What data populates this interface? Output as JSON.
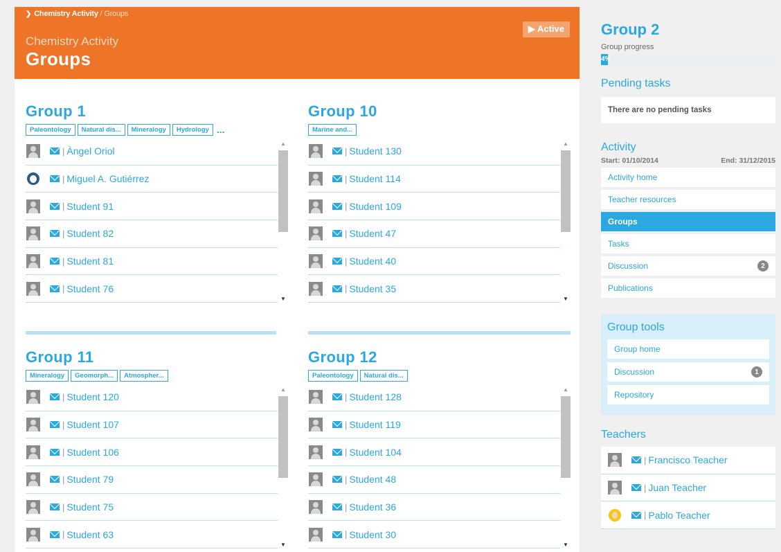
{
  "breadcrumb": {
    "parent": "Chemistry Activity",
    "separator": "/",
    "current": "Groups"
  },
  "hero": {
    "subtitle": "Chemistry Activity",
    "title": "Groups",
    "status": "Active"
  },
  "groups": [
    {
      "title": "Group 1",
      "tags": [
        "Paleontology",
        "Natural dis...",
        "Mineralogy",
        "Hydrology"
      ],
      "more": "...",
      "members": [
        {
          "name": "Àngel Oriol",
          "avatar": "default"
        },
        {
          "name": "Miguel A. Gutiérrez",
          "avatar": "penguin"
        },
        {
          "name": "Student 91",
          "avatar": "default"
        },
        {
          "name": "Student 82",
          "avatar": "default"
        },
        {
          "name": "Student 81",
          "avatar": "default"
        },
        {
          "name": "Student 76",
          "avatar": "default"
        }
      ]
    },
    {
      "title": "Group 10",
      "tags": [
        "Marine and..."
      ],
      "more": "",
      "members": [
        {
          "name": "Student 130",
          "avatar": "default"
        },
        {
          "name": "Student 114",
          "avatar": "default"
        },
        {
          "name": "Student 109",
          "avatar": "default"
        },
        {
          "name": "Student 47",
          "avatar": "default"
        },
        {
          "name": "Student 40",
          "avatar": "default"
        },
        {
          "name": "Student 35",
          "avatar": "default"
        }
      ]
    },
    {
      "title": "Group 11",
      "tags": [
        "Mineralogy",
        "Geomorph...",
        "Atmospher..."
      ],
      "more": "",
      "members": [
        {
          "name": "Student 120",
          "avatar": "default"
        },
        {
          "name": "Student 107",
          "avatar": "default"
        },
        {
          "name": "Student 106",
          "avatar": "default"
        },
        {
          "name": "Student 79",
          "avatar": "default"
        },
        {
          "name": "Student 75",
          "avatar": "default"
        },
        {
          "name": "Student 63",
          "avatar": "default"
        }
      ]
    },
    {
      "title": "Group 12",
      "tags": [
        "Paleontology",
        "Natural dis..."
      ],
      "more": "",
      "members": [
        {
          "name": "Student 128",
          "avatar": "default"
        },
        {
          "name": "Student 119",
          "avatar": "default"
        },
        {
          "name": "Student 104",
          "avatar": "default"
        },
        {
          "name": "Student 48",
          "avatar": "default"
        },
        {
          "name": "Student 36",
          "avatar": "default"
        },
        {
          "name": "Student 30",
          "avatar": "default"
        }
      ]
    }
  ],
  "sidebar": {
    "group_title": "Group 2",
    "progress_label": "Group progress",
    "progress_text": "4%",
    "progress_value": 4,
    "pending_heading": "Pending tasks",
    "pending_text": "There are no pending tasks",
    "activity_heading": "Activity",
    "start": "Start: 01/10/2014",
    "end": "End: 31/12/2015",
    "activity_menu": [
      {
        "label": "Activity home",
        "badge": "",
        "active": false
      },
      {
        "label": "Teacher resources",
        "badge": "",
        "active": false
      },
      {
        "label": "Groups",
        "badge": "",
        "active": true
      },
      {
        "label": "Tasks",
        "badge": "",
        "active": false
      },
      {
        "label": "Discussion",
        "badge": "2",
        "active": false
      },
      {
        "label": "Publications",
        "badge": "",
        "active": false
      }
    ],
    "tools_heading": "Group tools",
    "tools_menu": [
      {
        "label": "Group home",
        "badge": ""
      },
      {
        "label": "Discussion",
        "badge": "1"
      },
      {
        "label": "Repository",
        "badge": ""
      }
    ],
    "teachers_heading": "Teachers",
    "teachers": [
      {
        "name": "Francisco Teacher",
        "avatar": "default"
      },
      {
        "name": "Juan Teacher",
        "avatar": "default"
      },
      {
        "name": "Pablo Teacher",
        "avatar": "girl"
      }
    ]
  },
  "colors": {
    "accent": "#2aa8df",
    "hero": "#ee7528",
    "divider": "#b8e0f3"
  }
}
